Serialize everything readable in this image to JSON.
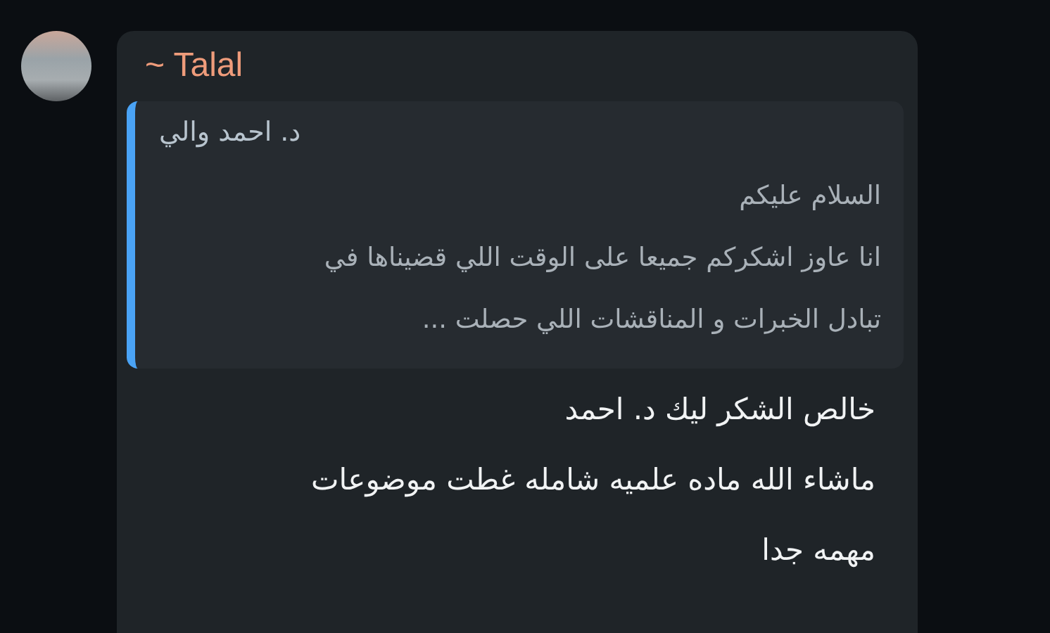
{
  "message": {
    "sender": "~ Talal",
    "quote": {
      "author": "د. احمد والي",
      "lines": [
        "السلام عليكم",
        "انا عاوز اشكركم جميعا على الوقت اللي قضيناها في",
        "تبادل الخبرات و المناقشات اللي حصلت ..."
      ]
    },
    "lines": [
      "خالص الشكر ليك د. احمد",
      "ماشاء الله ماده علميه شامله غطت موضوعات",
      "مهمه جدا"
    ]
  }
}
